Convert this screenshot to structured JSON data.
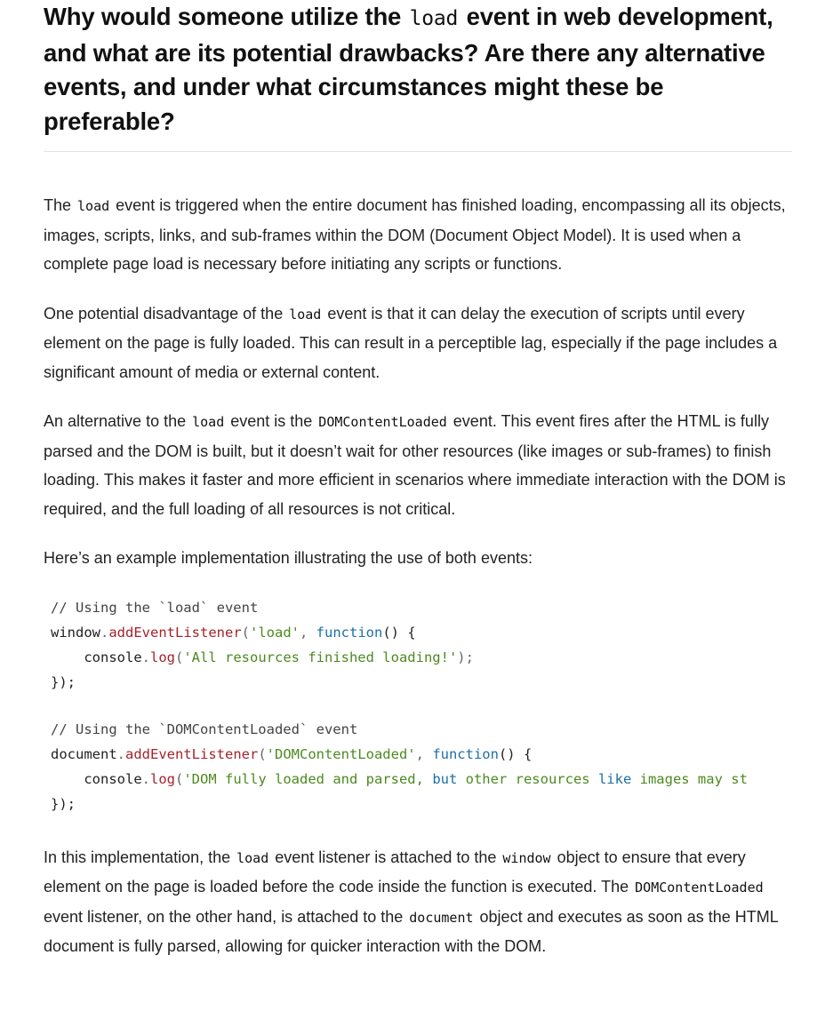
{
  "heading": {
    "part1": "Why would someone utilize the ",
    "code": "load",
    "part2": " event in web development, and what are its potential drawbacks? Are there any alternative events, and under what circumstances might these be preferable?"
  },
  "paragraphs": {
    "p1": {
      "a": "The ",
      "code1": "load",
      "b": " event is triggered when the entire document has finished loading, encompassing all its objects, images, scripts, links, and sub-frames within the DOM (Document Object Model). It is used when a complete page load is necessary before initiating any scripts or functions."
    },
    "p2": {
      "a": "One potential disadvantage of the ",
      "code1": "load",
      "b": " event is that it can delay the execution of scripts until every element on the page is fully loaded. This can result in a perceptible lag, especially if the page includes a significant amount of media or external content."
    },
    "p3": {
      "a": "An alternative to the ",
      "code1": "load",
      "b": " event is the ",
      "code2": "DOMContentLoaded",
      "c": " event. This event fires after the HTML is fully parsed and the DOM is built, but it doesn’t wait for other resources (like images or sub-frames) to finish loading. This makes it faster and more efficient in scenarios where immediate interaction with the DOM is required, and the full loading of all resources is not critical."
    },
    "p4": {
      "a": "Here’s an example implementation illustrating the use of both events:"
    },
    "p5": {
      "a": "In this implementation, the ",
      "code1": "load",
      "b": " event listener is attached to the ",
      "code2": "window",
      "c": " object to ensure that every element on the page is loaded before the code inside the function is executed. The ",
      "code3": "DOMContentLoaded",
      "d": " event listener, on the other hand, is attached to the ",
      "code4": "document",
      "e": " object and executes as soon as the HTML document is fully parsed, allowing for quicker interaction with the DOM."
    }
  },
  "code_block_1": {
    "comment": "// Using the `load` event",
    "obj": "window",
    "dot": ".",
    "method": "addEventListener",
    "open_paren": "(",
    "arg": "'load'",
    "comma": ", ",
    "keyword": "function",
    "fn_open": "() {",
    "indent": "    ",
    "log_obj": "console",
    "log_dot": ".",
    "log_method": "log",
    "log_open": "(",
    "log_string": "'All resources finished loading!'",
    "log_close": ");",
    "close": "});"
  },
  "code_block_2": {
    "comment": "// Using the `DOMContentLoaded` event",
    "obj": "document",
    "dot": ".",
    "method": "addEventListener",
    "open_paren": "(",
    "arg": "'DOMContentLoaded'",
    "comma": ", ",
    "keyword": "function",
    "fn_open": "() {",
    "indent": "    ",
    "log_obj": "console",
    "log_dot": ".",
    "log_method": "log",
    "log_open": "(",
    "log_string_a": "'DOM fully loaded and parsed, ",
    "log_string_kw": "but",
    "log_string_b": " other resources ",
    "log_string_kw2": "like",
    "log_string_c": " images may st",
    "close": "});"
  }
}
